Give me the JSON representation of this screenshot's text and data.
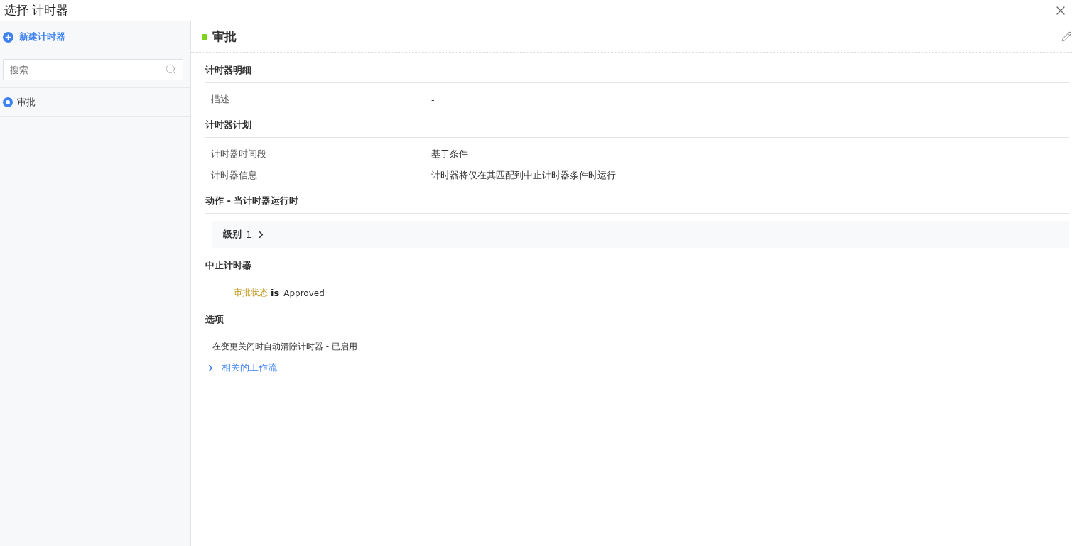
{
  "window": {
    "title": "选择 计时器"
  },
  "sidebar": {
    "new_button": "新建计时器",
    "search": {
      "placeholder": "搜索"
    },
    "items": [
      {
        "label": "审批",
        "selected": true
      }
    ]
  },
  "detail": {
    "title": "审批",
    "sections": [
      {
        "kind": "fields",
        "heading": "计时器明细",
        "rows": [
          {
            "label": "描述",
            "value": "-"
          }
        ]
      },
      {
        "kind": "fields",
        "heading": "计时器计划",
        "rows": [
          {
            "label": "计时器时间段",
            "value": "基于条件"
          },
          {
            "label": "计时器信息",
            "value": "计时器将仅在其匹配到中止计时器条件时运行"
          }
        ]
      },
      {
        "kind": "levels",
        "heading": "动作 - 当计时器运行时",
        "levels": [
          {
            "label": "级别",
            "number": "1",
            "expanded": false
          }
        ]
      },
      {
        "kind": "condition",
        "heading": "中止计时器",
        "field": "审批状态",
        "operator": "is",
        "value": "Approved"
      },
      {
        "kind": "text",
        "heading": "选项",
        "text": "在变更关闭时自动清除计时器 -  已启用"
      }
    ],
    "related": {
      "label": "相关的工作流",
      "expanded": false
    }
  }
}
